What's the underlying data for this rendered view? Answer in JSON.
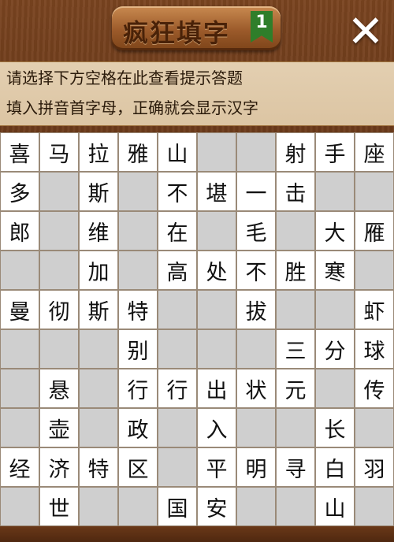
{
  "header": {
    "title": "疯狂填字",
    "level": "1",
    "close_label": "✕"
  },
  "hints": {
    "line1": "请选择下方空格在此查看提示答题",
    "line2": "填入拼音首字母，正确就会显示汉字"
  },
  "board": {
    "rows": [
      [
        "喜",
        "马",
        "拉",
        "雅",
        "山",
        "",
        "",
        "射",
        "手",
        "座"
      ],
      [
        "多",
        "",
        "斯",
        "",
        "不",
        "堪",
        "一",
        "击",
        "",
        ""
      ],
      [
        "郎",
        "",
        "维",
        "",
        "在",
        "",
        "毛",
        "",
        "大",
        "雁"
      ],
      [
        "",
        "",
        "加",
        "",
        "高",
        "处",
        "不",
        "胜",
        "寒",
        ""
      ],
      [
        "曼",
        "彻",
        "斯",
        "特",
        "",
        "",
        "拔",
        "",
        "",
        "虾"
      ],
      [
        "",
        "",
        "",
        "别",
        "",
        "",
        "",
        "三",
        "分",
        "球"
      ],
      [
        "",
        "悬",
        "",
        "行",
        "行",
        "出",
        "状",
        "元",
        "",
        "传"
      ],
      [
        "",
        "壶",
        "",
        "政",
        "",
        "入",
        "",
        "",
        "长",
        ""
      ],
      [
        "经",
        "济",
        "特",
        "区",
        "",
        "平",
        "明",
        "寻",
        "白",
        "羽"
      ],
      [
        "",
        "世",
        "",
        "",
        "国",
        "安",
        "",
        "",
        "山",
        ""
      ]
    ]
  },
  "colors": {
    "wood": "#6b3a1a",
    "hint_bg": "#e3cfb1",
    "empty_cell": "#cfcfcf",
    "flag": "#2f7e2a"
  }
}
